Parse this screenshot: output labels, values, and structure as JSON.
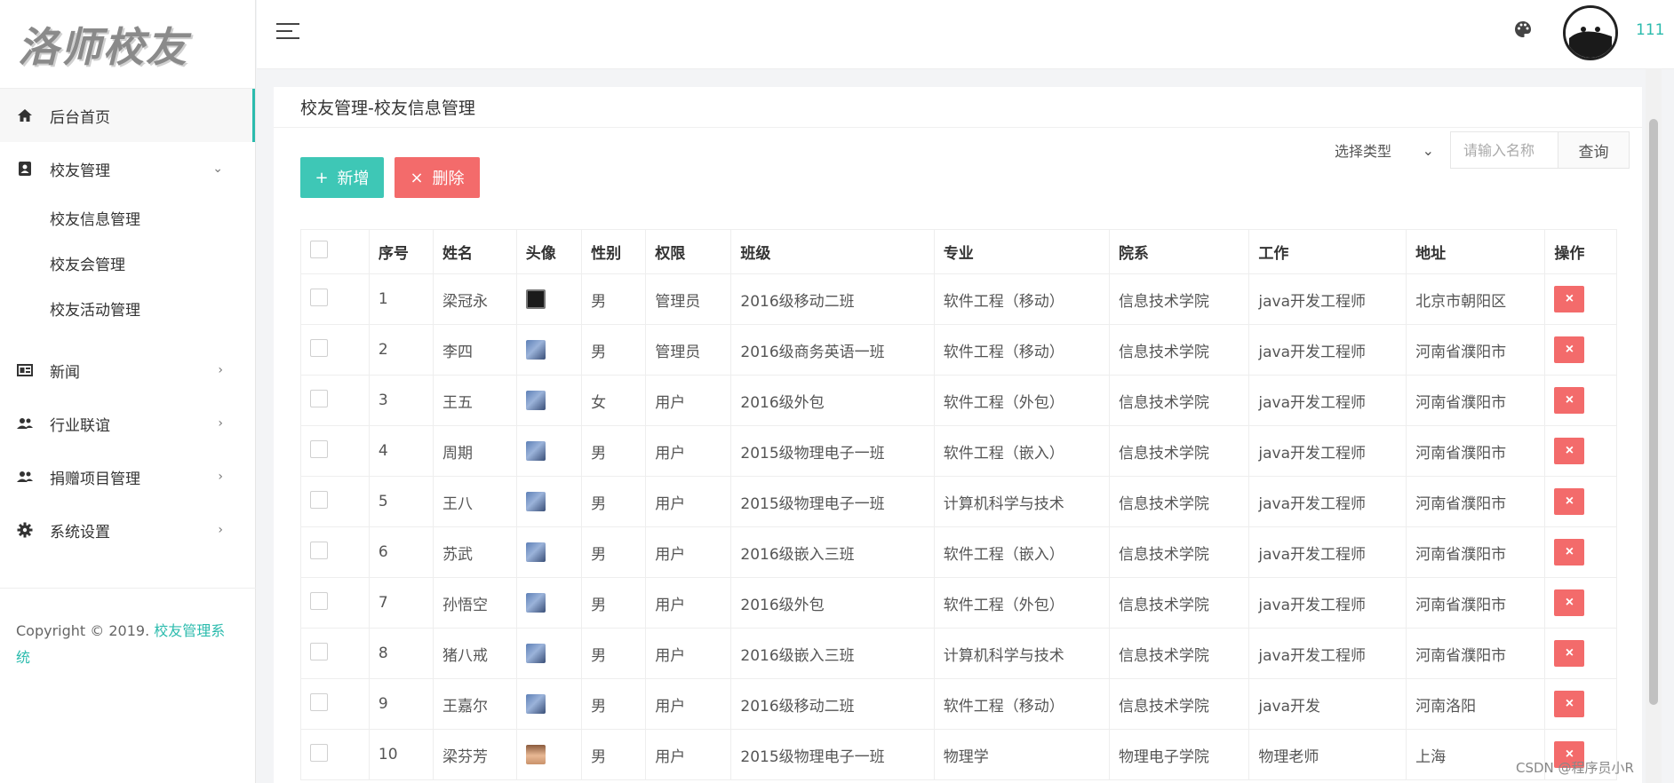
{
  "logo": {
    "text": "洛师校友"
  },
  "sidebar": {
    "items": [
      {
        "label": "后台首页",
        "icon": "home-icon",
        "active": true,
        "arrow": ""
      },
      {
        "label": "校友管理",
        "icon": "contact-card-icon",
        "arrow": "⌄",
        "children": [
          "校友信息管理",
          "校友会管理",
          "校友活动管理"
        ]
      },
      {
        "label": "新闻",
        "icon": "news-icon",
        "arrow": "›"
      },
      {
        "label": "行业联谊",
        "icon": "people-icon",
        "arrow": "›"
      },
      {
        "label": "捐赠项目管理",
        "icon": "people-add-icon",
        "arrow": "›"
      },
      {
        "label": "系统设置",
        "icon": "gear-icon",
        "arrow": "›"
      }
    ],
    "copyright_prefix": "Copyright © 2019.",
    "copyright_brand": "校友管理系统"
  },
  "header": {
    "user_name": "111"
  },
  "main": {
    "breadcrumb": "校友管理-校友信息管理",
    "add_label": "新增",
    "delete_label": "删除",
    "select_type": "选择类型",
    "search_placeholder": "请输入名称",
    "search_button": "查询",
    "columns": [
      "序号",
      "姓名",
      "头像",
      "性别",
      "权限",
      "班级",
      "专业",
      "院系",
      "工作",
      "地址",
      "操作"
    ],
    "rows": [
      {
        "no": "1",
        "name": "梁冠永",
        "avatar": "dark",
        "gender": "男",
        "role": "管理员",
        "class": "2016级移动二班",
        "major": "软件工程（移动）",
        "dept": "信息技术学院",
        "job": "java开发工程师",
        "addr": "北京市朝阳区"
      },
      {
        "no": "2",
        "name": "李四",
        "avatar": "blue",
        "gender": "男",
        "role": "管理员",
        "class": "2016级商务英语一班",
        "major": "软件工程（移动）",
        "dept": "信息技术学院",
        "job": "java开发工程师",
        "addr": "河南省濮阳市"
      },
      {
        "no": "3",
        "name": "王五",
        "avatar": "blue",
        "gender": "女",
        "role": "用户",
        "class": "2016级外包",
        "major": "软件工程（外包）",
        "dept": "信息技术学院",
        "job": "java开发工程师",
        "addr": "河南省濮阳市"
      },
      {
        "no": "4",
        "name": "周期",
        "avatar": "blue",
        "gender": "男",
        "role": "用户",
        "class": "2015级物理电子一班",
        "major": "软件工程（嵌入）",
        "dept": "信息技术学院",
        "job": "java开发工程师",
        "addr": "河南省濮阳市"
      },
      {
        "no": "5",
        "name": "王八",
        "avatar": "blue",
        "gender": "男",
        "role": "用户",
        "class": "2015级物理电子一班",
        "major": "计算机科学与技术",
        "dept": "信息技术学院",
        "job": "java开发工程师",
        "addr": "河南省濮阳市"
      },
      {
        "no": "6",
        "name": "苏武",
        "avatar": "blue",
        "gender": "男",
        "role": "用户",
        "class": "2016级嵌入三班",
        "major": "软件工程（嵌入）",
        "dept": "信息技术学院",
        "job": "java开发工程师",
        "addr": "河南省濮阳市"
      },
      {
        "no": "7",
        "name": "孙悟空",
        "avatar": "blue",
        "gender": "男",
        "role": "用户",
        "class": "2016级外包",
        "major": "软件工程（外包）",
        "dept": "信息技术学院",
        "job": "java开发工程师",
        "addr": "河南省濮阳市"
      },
      {
        "no": "8",
        "name": "猪八戒",
        "avatar": "blue",
        "gender": "男",
        "role": "用户",
        "class": "2016级嵌入三班",
        "major": "计算机科学与技术",
        "dept": "信息技术学院",
        "job": "java开发工程师",
        "addr": "河南省濮阳市"
      },
      {
        "no": "9",
        "name": "王嘉尔",
        "avatar": "blue",
        "gender": "男",
        "role": "用户",
        "class": "2016级移动二班",
        "major": "软件工程（移动）",
        "dept": "信息技术学院",
        "job": "java开发",
        "addr": "河南洛阳"
      },
      {
        "no": "10",
        "name": "梁芬芳",
        "avatar": "face",
        "gender": "男",
        "role": "用户",
        "class": "2015级物理电子一班",
        "major": "物理学",
        "dept": "物理电子学院",
        "job": "物理老师",
        "addr": "上海"
      }
    ],
    "row_delete_glyph": "×"
  },
  "watermark": {
    "csdn": "CSDN @程序员小R"
  },
  "colors": {
    "accent": "#2bbbad",
    "add": "#3ec7b6",
    "danger": "#f36b6b"
  }
}
